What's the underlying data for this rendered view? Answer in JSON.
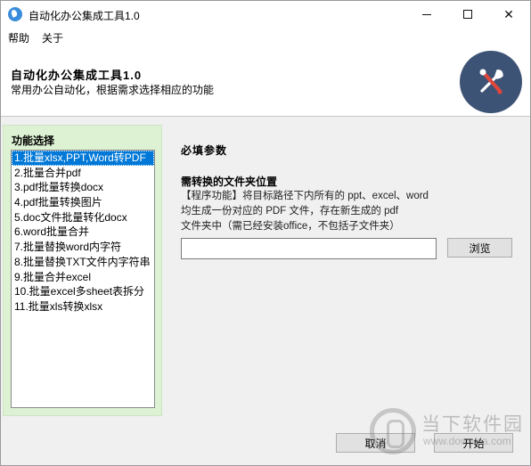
{
  "window": {
    "title": "自动化办公集成工具1.0",
    "minimize_icon": "minimize-icon",
    "maximize_icon": "maximize-icon",
    "close_icon": "close-icon",
    "close_glyph": "✕"
  },
  "menu": {
    "items": [
      {
        "label": "帮助"
      },
      {
        "label": "关于"
      }
    ]
  },
  "header": {
    "title": "自动化办公集成工具1.0",
    "subtitle": "常用办公自动化，根据需求选择相应的功能",
    "badge_icon": "tools-icon",
    "badge_color": "#3d5375"
  },
  "left_panel": {
    "title": "功能选择",
    "background": "#ddf2d3",
    "items": [
      {
        "label": "1.批量xlsx,PPT,Word转PDF",
        "selected": true
      },
      {
        "label": "2.批量合并pdf",
        "selected": false
      },
      {
        "label": "3.pdf批量转换docx",
        "selected": false
      },
      {
        "label": "4.pdf批量转换图片",
        "selected": false
      },
      {
        "label": "5.doc文件批量转化docx",
        "selected": false
      },
      {
        "label": "6.word批量合并",
        "selected": false
      },
      {
        "label": "7.批量替换word内字符",
        "selected": false
      },
      {
        "label": "8.批量替换TXT文件内字符串",
        "selected": false
      },
      {
        "label": "9.批量合并excel",
        "selected": false
      },
      {
        "label": "10.批量excel多sheet表拆分",
        "selected": false
      },
      {
        "label": "11.批量xls转换xlsx",
        "selected": false
      }
    ]
  },
  "main": {
    "section_title": "必填参数",
    "field_label": "需转换的文件夹位置",
    "description": [
      "【程序功能】将目标路径下内所有的 ppt、excel、word",
      "均生成一份对应的 PDF 文件，存在新生成的 pdf",
      "文件夹中（需已经安装office，不包括子文件夹）"
    ],
    "path_value": "",
    "browse_label": "浏览"
  },
  "footer": {
    "cancel_label": "取消",
    "start_label": "开始"
  },
  "watermark": {
    "text": "当下软件园",
    "url": "www.downxia.com",
    "logo_icon": "downxia-logo-icon"
  },
  "colors": {
    "selection": "#0078d7",
    "accent": "#3a8ddb"
  }
}
